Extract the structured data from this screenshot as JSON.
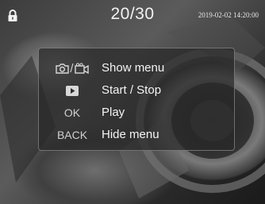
{
  "status": {
    "counter": "20/30",
    "datetime": "2019-02-02  14:20:00"
  },
  "menu": {
    "items": [
      {
        "key_icons": [
          "camera-icon",
          "video-camera-icon"
        ],
        "key_text": "/",
        "label": "Show menu"
      },
      {
        "key_icons": [
          "play-icon"
        ],
        "key_text": "",
        "label": "Start / Stop"
      },
      {
        "key_icons": [],
        "key_text": "OK",
        "label": "Play"
      },
      {
        "key_icons": [],
        "key_text": "BACK",
        "label": "Hide menu"
      }
    ]
  },
  "icons": {
    "status": "lock-icon"
  }
}
